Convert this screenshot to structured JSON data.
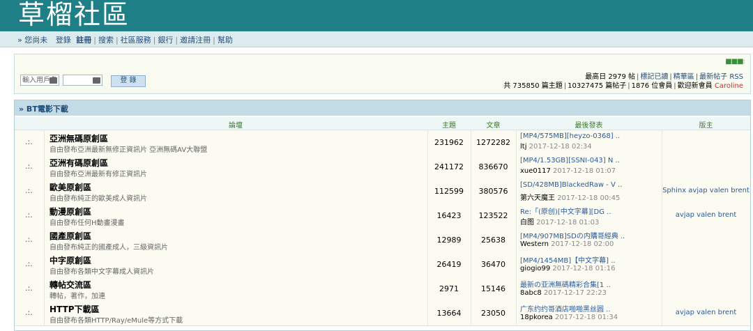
{
  "header": {
    "title": "草榴社區"
  },
  "topnav": {
    "prefix": "» 您尚未",
    "login": "登錄",
    "register": "註冊",
    "search": "搜索",
    "services": "社區服務",
    "bank": "銀行",
    "invite": "邀請注冊",
    "help": "幫助"
  },
  "login": {
    "username_placeholder": "輸入用戶名",
    "password_value": "",
    "button": "登 錄"
  },
  "stats": {
    "line1_prefix": "最高日",
    "max_day": "2979",
    "line1_unit": "帖",
    "mark_read": "標記已讀",
    "featured": "精華區",
    "latest": "最新帖子",
    "rss": "RSS",
    "total_prefix": "共",
    "topics": "735850",
    "topics_label": "篇主題",
    "posts": "10327475",
    "posts_label": "篇帖子",
    "members": "1876",
    "members_label": "位會員",
    "welcome": "歡迎新會員",
    "new_member": "Caroline"
  },
  "section": {
    "title": "» BT電影下載",
    "columns": {
      "forum": "論壇",
      "topics": "主題",
      "posts": "文章",
      "last": "最後發表",
      "mod": "版主"
    }
  },
  "forums": [
    {
      "icon": ".:.",
      "name": "亞洲無碼原創區",
      "desc": "自由發布亞洲最新無修正資訊片 亞洲無碼AV大聯盟",
      "topics": "231962",
      "posts": "1272282",
      "last_title": "[MP4/575MB][heyzo-0368] ..",
      "last_user": "ltj",
      "last_time": "2017-12-18 02:34",
      "mod": ""
    },
    {
      "icon": ".:.",
      "name": "亞洲有碼原創區",
      "desc": "自由發布亞洲最新有修正資訊片",
      "topics": "241172",
      "posts": "836670",
      "last_title": "[MP4/1.53GB][SSNI-043] N ..",
      "last_user": "xue0117",
      "last_time": "2017-12-18 01:07",
      "mod": ""
    },
    {
      "icon": ".:.",
      "name": "歐美原創區",
      "desc": "自由發布純正的歐美成人資訊片",
      "topics": "112599",
      "posts": "380576",
      "last_title": "[SD/428MB]BlackedRaw - V ..",
      "last_user": "第六天魔王",
      "last_time": "2017-12-18 00:45",
      "mod": "Sphinx avjap valen brent"
    },
    {
      "icon": ".:.",
      "name": "動漫原創區",
      "desc": "自由發布任何H動畫漫畫",
      "topics": "16423",
      "posts": "123522",
      "last_title": "Re:「(原创)[中文字幕][DG ..",
      "last_user": "白图",
      "last_time": "2017-12-18 01:03",
      "mod": "avjap valen brent"
    },
    {
      "icon": ".:.",
      "name": "國產原創區",
      "desc": "自由發布純正的國產成人，三級資訊片",
      "topics": "12989",
      "posts": "25638",
      "last_title": "[MP4/907MB]SDの内購哥經典 ..",
      "last_user": "Western",
      "last_time": "2017-12-18 02:00",
      "mod": ""
    },
    {
      "icon": ".:.",
      "name": "中字原創區",
      "desc": "自由發布各類中文字幕成人資訊片",
      "topics": "26419",
      "posts": "36470",
      "last_title": "[MP4/1454MB]【中文字幕] ..",
      "last_user": "giogio99",
      "last_time": "2017-12-18 01:16",
      "mod": ""
    },
    {
      "icon": ".:.",
      "name": "轉帖交流區",
      "desc": "轉帖，著作，加連",
      "topics": "2971",
      "posts": "15146",
      "last_title": "最新の亚洲無碼精彩合集[1 ..",
      "last_user": "8abc8",
      "last_time": "2017-12-17 22:23",
      "mod": ""
    },
    {
      "icon": ".:.",
      "name": "HTTP下載區",
      "desc": "自由發布各類HTTP/Ray/eMule等方式下載",
      "topics": "13664",
      "posts": "23050",
      "last_title": "广东约约哥酒店啪啪黑丝圆 ..",
      "last_user": "18pkorea",
      "last_time": "2017-12-18 01:34",
      "mod": "avjap valen brent"
    }
  ]
}
